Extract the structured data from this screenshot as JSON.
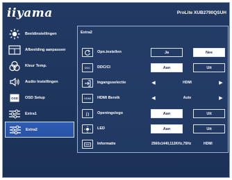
{
  "brand": "iiyama",
  "model": "ProLite XUB2790QSUH",
  "sidebar": {
    "items": [
      {
        "label": "Beeldinstellingen",
        "icon": "brightness-icon"
      },
      {
        "label": "Afbeelding aanpassen",
        "icon": "picture-adjust-icon"
      },
      {
        "label": "Kleur Temp.",
        "icon": "color-temp-icon"
      },
      {
        "label": "Audio Instellingen",
        "icon": "speaker-icon"
      },
      {
        "label": "OSD Setup",
        "icon": "osd-icon"
      },
      {
        "label": "Extra1",
        "icon": "sliders-icon"
      },
      {
        "label": "Extra2",
        "icon": "sliders-icon"
      }
    ],
    "active_index": 6
  },
  "panel": {
    "title": "Extra2",
    "rows": [
      {
        "label": "Opn.instellen",
        "icon_text": "",
        "options": [
          "Ja",
          "Nee"
        ],
        "selected": 1
      },
      {
        "label": "DDC/CI",
        "icon_text": "DDC",
        "options": [
          "Aan",
          "Uit"
        ],
        "selected": 0
      },
      {
        "label": "Ingangsselectie",
        "icon_text": "",
        "value": "HDMI"
      },
      {
        "label": "HDMI Bereik",
        "icon_text": "HDMI",
        "value": "Auto"
      },
      {
        "label": "Openingslogo",
        "icon_text": "",
        "options": [
          "Aan",
          "Uit"
        ],
        "selected": 0
      },
      {
        "label": "LED",
        "icon_text": "",
        "options": [
          "Aan",
          "Uit"
        ],
        "selected": 0
      },
      {
        "label": "Informatie",
        "icon_text": "",
        "info": [
          "2560x1440,112KHz,75Hz",
          "HDMI"
        ]
      }
    ]
  },
  "colors": {
    "background": "#1e355c",
    "active_tab": "#2c58ad",
    "border": "#9bb0d2",
    "text": "#ffffff"
  }
}
